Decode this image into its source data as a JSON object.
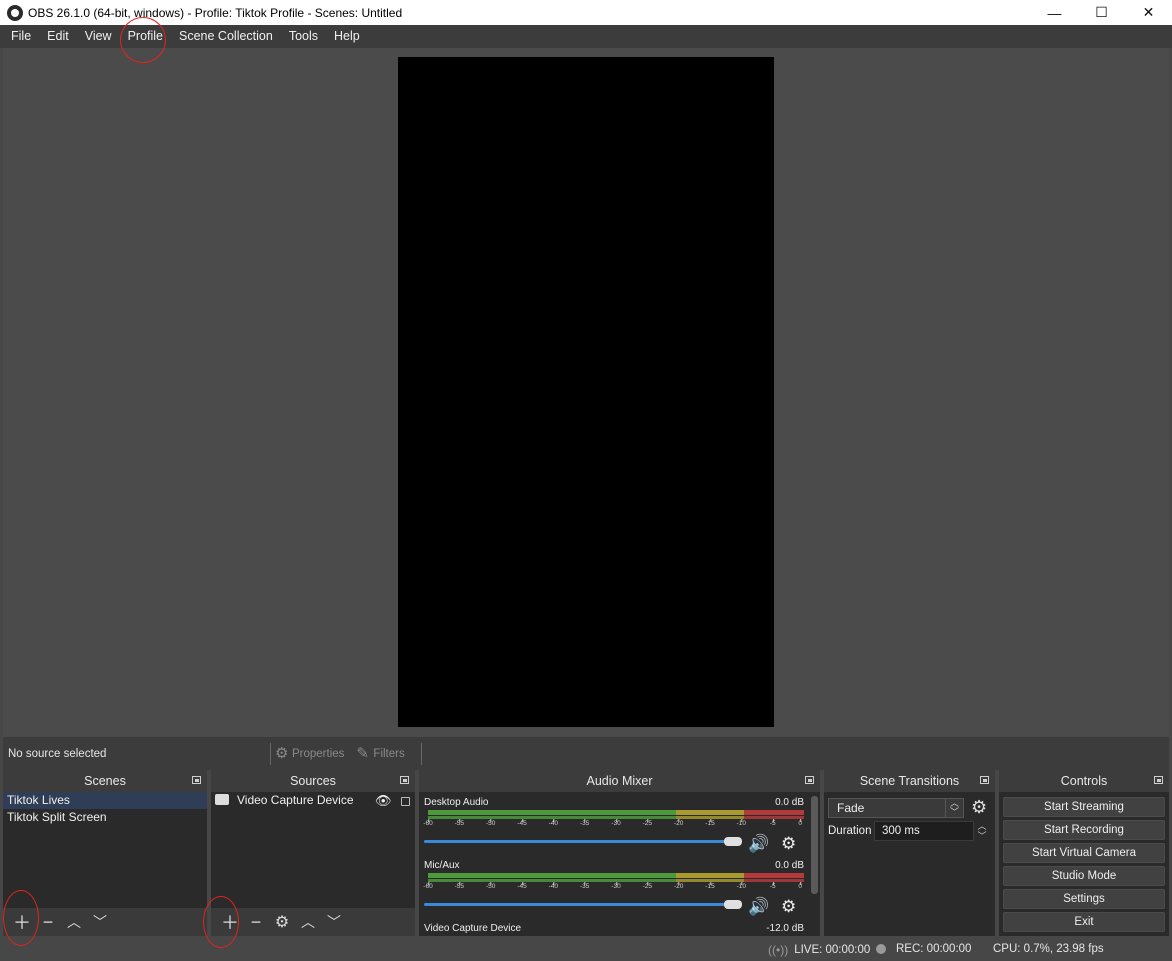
{
  "window": {
    "title": "OBS 26.1.0 (64-bit, windows) - Profile: Tiktok Profile - Scenes: Untitled",
    "minimize": "—",
    "maximize": "☐",
    "close": "✕"
  },
  "menu": [
    "File",
    "Edit",
    "View",
    "Profile",
    "Scene Collection",
    "Tools",
    "Help"
  ],
  "source_toolbar": {
    "no_source": "No source selected",
    "properties": "Properties",
    "filters": "Filters"
  },
  "docks": {
    "scenes": {
      "title": "Scenes",
      "items": [
        "Tiktok Lives",
        "Tiktok Split Screen"
      ],
      "selected_index": 0
    },
    "sources": {
      "title": "Sources",
      "items": [
        "Video Capture Device"
      ]
    },
    "audio_mixer": {
      "title": "Audio Mixer",
      "ticks": [
        "-60",
        "-55",
        "-50",
        "-45",
        "-40",
        "-35",
        "-30",
        "-25",
        "-20",
        "-15",
        "-10",
        "-5",
        "0"
      ],
      "channels": [
        {
          "name": "Desktop Audio",
          "db": "0.0 dB"
        },
        {
          "name": "Mic/Aux",
          "db": "0.0 dB"
        },
        {
          "name": "Video Capture Device",
          "db": "-12.0 dB"
        }
      ]
    },
    "scene_transitions": {
      "title": "Scene Transitions",
      "transition": "Fade",
      "duration_label": "Duration",
      "duration_value": "300 ms"
    },
    "controls": {
      "title": "Controls",
      "buttons": [
        "Start Streaming",
        "Start Recording",
        "Start Virtual Camera",
        "Studio Mode",
        "Settings",
        "Exit"
      ]
    }
  },
  "status": {
    "live": "LIVE: 00:00:00",
    "rec": "REC: 00:00:00",
    "cpu": "CPU: 0.7%, 23.98 fps"
  },
  "colors": {
    "selection": "#2f3e56",
    "fader": "#3a8ad9",
    "annotation": "#e0251c"
  }
}
